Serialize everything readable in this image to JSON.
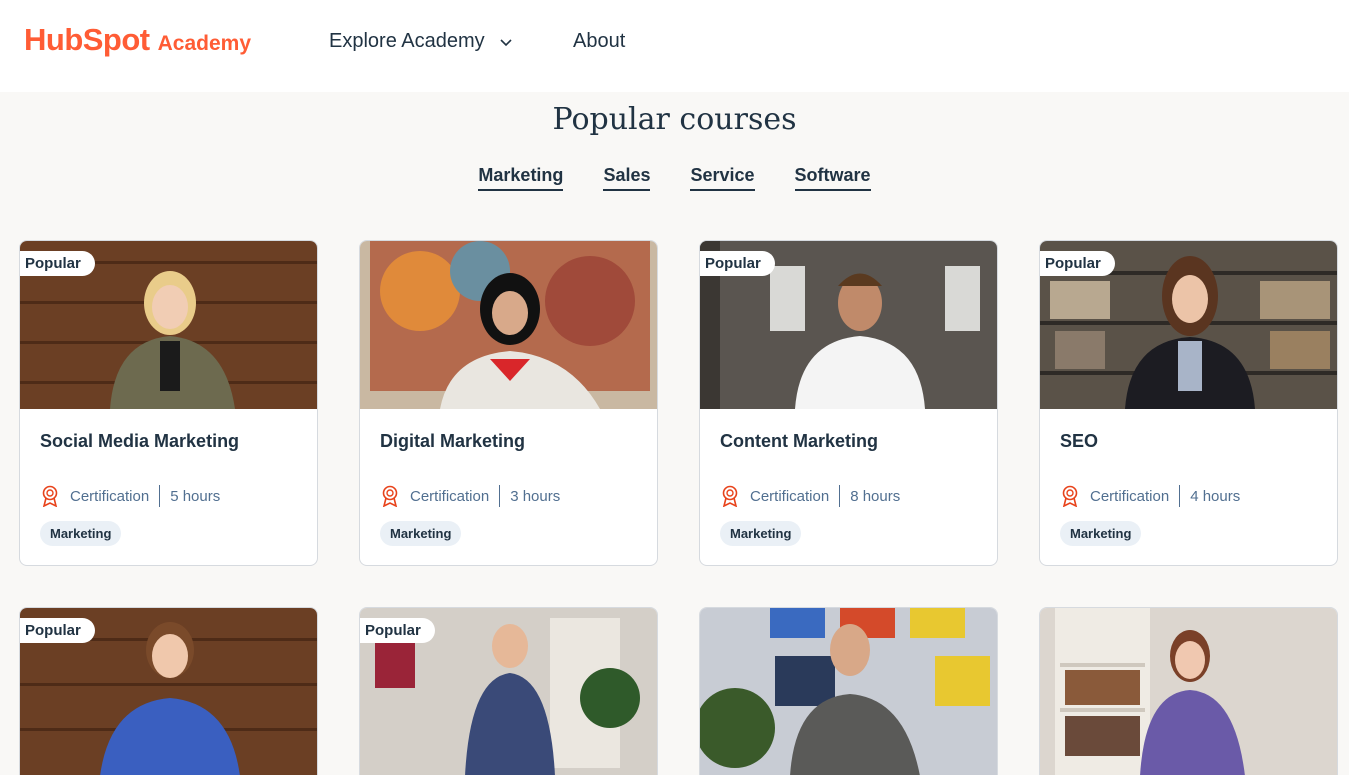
{
  "header": {
    "logo_hub": "HubSpot",
    "logo_academy": "Academy",
    "nav": {
      "explore_label": "Explore Academy",
      "about_label": "About"
    }
  },
  "section": {
    "title": "Popular courses",
    "tabs": [
      "Marketing",
      "Sales",
      "Service",
      "Software"
    ]
  },
  "courses": [
    {
      "title": "Social Media Marketing",
      "badge": "Popular",
      "type": "Certification",
      "duration": "5 hours",
      "tag": "Marketing"
    },
    {
      "title": "Digital Marketing",
      "badge": "",
      "type": "Certification",
      "duration": "3 hours",
      "tag": "Marketing"
    },
    {
      "title": "Content Marketing",
      "badge": "Popular",
      "type": "Certification",
      "duration": "8 hours",
      "tag": "Marketing"
    },
    {
      "title": "SEO",
      "badge": "Popular",
      "type": "Certification",
      "duration": "4 hours",
      "tag": "Marketing"
    }
  ],
  "courses_row2": [
    {
      "badge": "Popular"
    },
    {
      "badge": "Popular"
    },
    {
      "badge": ""
    },
    {
      "badge": ""
    }
  ],
  "colors": {
    "brand": "#ff5c35",
    "text": "#213343",
    "muted": "#516f90",
    "background": "#f9f8f6",
    "tag_bg": "#eaf0f6"
  }
}
